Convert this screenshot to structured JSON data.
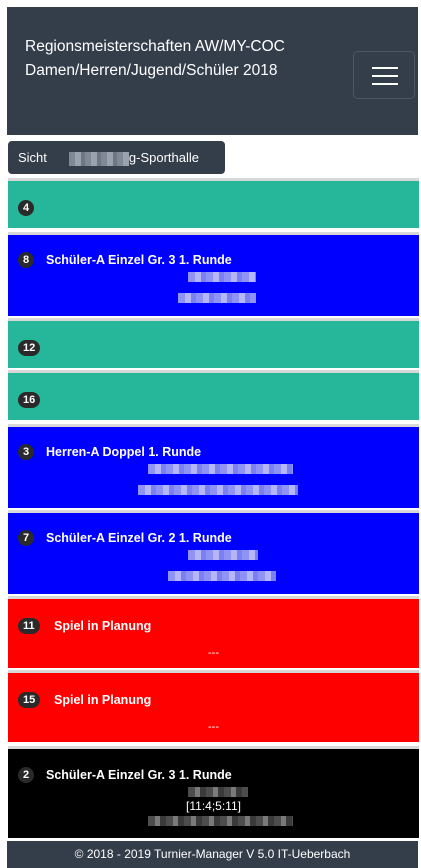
{
  "header": {
    "title": "Regionsmeisterschaften AW/MY-COC Damen/Herren/Jugend/Schüler 2018",
    "menu_icon": "hamburger-icon"
  },
  "view": {
    "prefix": "Sicht",
    "hall_suffix": "g-Sporthalle"
  },
  "matches": [
    {
      "number": "4",
      "title": "",
      "status": "free"
    },
    {
      "number": "8",
      "title": "Schüler-A Einzel Gr. 3 1. Runde",
      "status": "running"
    },
    {
      "number": "12",
      "title": "",
      "status": "free"
    },
    {
      "number": "16",
      "title": "",
      "status": "free"
    },
    {
      "number": "3",
      "title": "Herren-A Doppel 1. Runde",
      "status": "running"
    },
    {
      "number": "7",
      "title": "Schüler-A Einzel Gr. 2 1. Runde",
      "status": "running"
    },
    {
      "number": "11",
      "title": "Spiel in Planung",
      "players": "---",
      "status": "planned"
    },
    {
      "number": "15",
      "title": "Spiel in Planung",
      "players": "---",
      "status": "planned"
    },
    {
      "number": "2",
      "title": "Schüler-A Einzel Gr. 3 1. Runde",
      "score": "[11:4;5:11]",
      "status": "finished"
    }
  ],
  "colors": {
    "free": "#26b79a",
    "running": "#0000ff",
    "planned": "#ff0000",
    "finished": "#000000",
    "navbar": "#343d4a"
  },
  "footer": {
    "text": "© 2018 - 2019 Turnier-Manager V 5.0 IT-Ueberbach"
  }
}
